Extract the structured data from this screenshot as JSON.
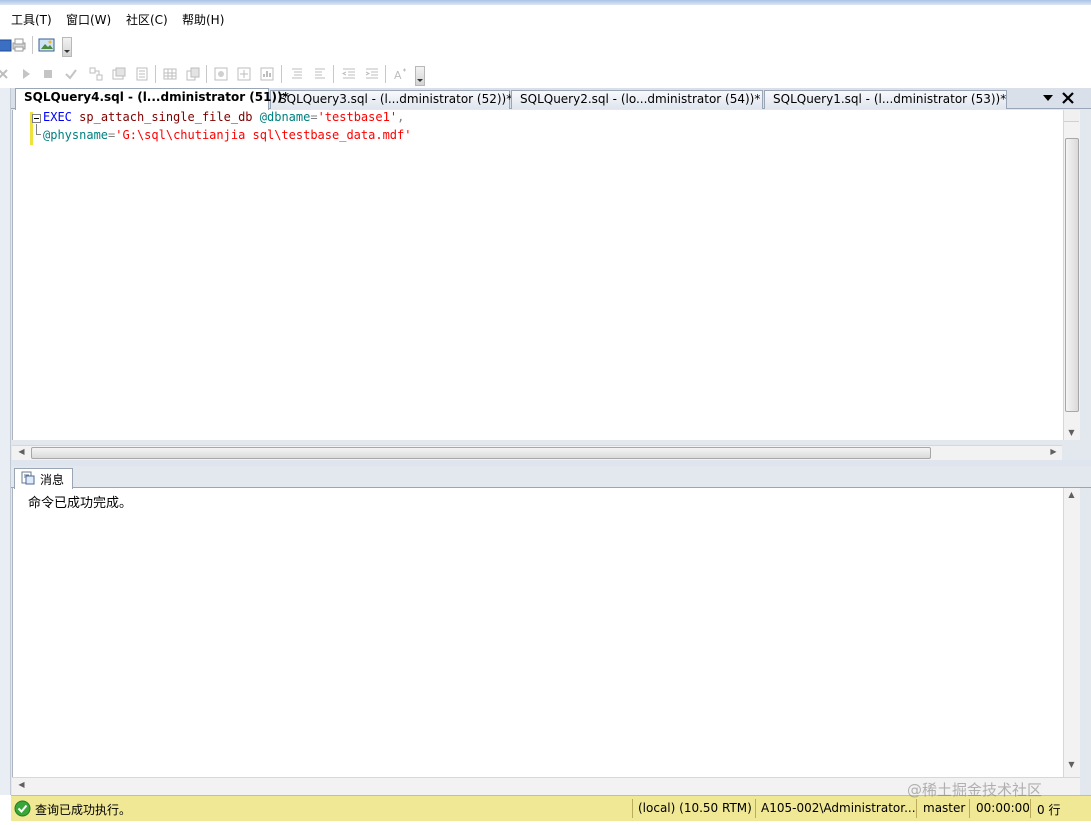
{
  "menu": {
    "items": [
      {
        "label": "工具(T)"
      },
      {
        "label": "窗口(W)"
      },
      {
        "label": "社区(C)"
      },
      {
        "label": "帮助(H)"
      }
    ]
  },
  "toolbar1": {
    "buttons": [
      "open-icon",
      "print-icon",
      "image-icon"
    ]
  },
  "toolbar2": {
    "buttons": [
      "cancel-icon",
      "execute-icon",
      "stop-icon",
      "parse-icon",
      "query-plan-icon",
      "query-options-icon",
      "results-icon",
      "grid-icon",
      "file-icon",
      "estimate-icon",
      "indent-icon",
      "outdent-icon",
      "comment-icon",
      "uncomment-icon",
      "font-icon"
    ]
  },
  "tabs": [
    {
      "label": "SQLQuery4.sql - (l...dministrator (51))*",
      "active": true
    },
    {
      "label": "SQLQuery3.sql - (l...dministrator (52))*",
      "active": false
    },
    {
      "label": "SQLQuery2.sql - (lo...dministrator (54))*",
      "active": false
    },
    {
      "label": "SQLQuery1.sql - (l...dministrator (53))*",
      "active": false
    }
  ],
  "tab_controls": {
    "dropdown_icon": "chevron-down-icon",
    "close_icon": "close-icon"
  },
  "editor": {
    "line1": {
      "kw": "EXEC",
      "proc": "sp_attach_single_file_db",
      "param": "@dbname",
      "eq": "=",
      "value": "'testbase1'",
      "comma": ","
    },
    "line2": {
      "param": "@physname",
      "eq": "=",
      "value": "'G:\\sql\\chutianjia sql\\testbase_data.mdf'"
    }
  },
  "results": {
    "tab_label": "消息",
    "tab_icon": "message-icon",
    "message": "命令已成功完成。"
  },
  "status": {
    "icon": "check-circle-icon",
    "text": "查询已成功执行。",
    "server": "(local) (10.50 RTM)",
    "login": "A105-002\\Administrator...",
    "database": "master",
    "elapsed": "00:00:00",
    "rows": "0 行"
  },
  "watermark": "@稀土掘金技术社区",
  "colors": {
    "status_bar": "#f0e895",
    "keyword": "#0000ff",
    "string": "#ff0000",
    "variable": "#008080"
  }
}
